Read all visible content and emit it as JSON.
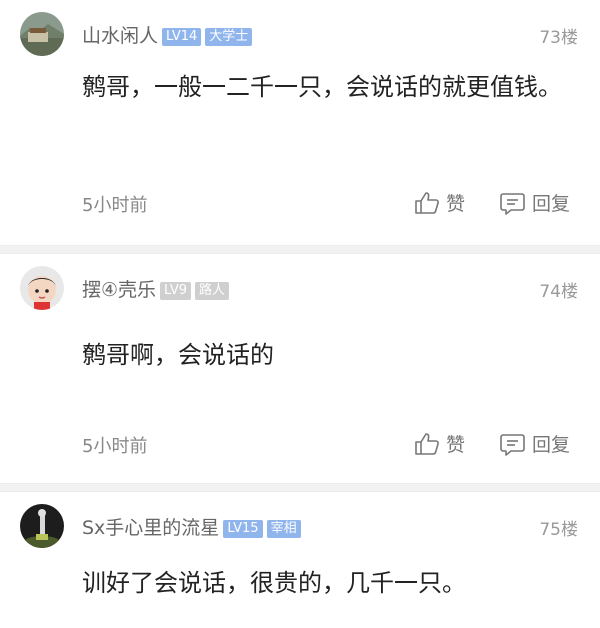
{
  "comments": [
    {
      "username": "山水闲人",
      "level": "LV14",
      "title": "大学士",
      "floor": "73楼",
      "text": "鹩哥，一般一二千一只，会说话的就更值钱。",
      "time": "5小时前",
      "like_label": "赞",
      "reply_label": "回复",
      "badge_style": "blue"
    },
    {
      "username": "摆④壳乐",
      "level": "LV9",
      "title": "路人",
      "floor": "74楼",
      "text": "鹩哥啊，会说话的",
      "time": "5小时前",
      "like_label": "赞",
      "reply_label": "回复",
      "badge_style": "grey"
    },
    {
      "username": "Sx手心里的流星",
      "level": "LV15",
      "title": "宰相",
      "floor": "75楼",
      "text": "训好了会说话，很贵的，几千一只。",
      "badge_style": "blue"
    }
  ],
  "icons": [
    "thumbs-up-icon",
    "comment-reply-icon"
  ],
  "colors": {
    "badge_blue": "#8fb5ec",
    "badge_grey": "#cfcfcf",
    "meta_text": "#888888"
  }
}
